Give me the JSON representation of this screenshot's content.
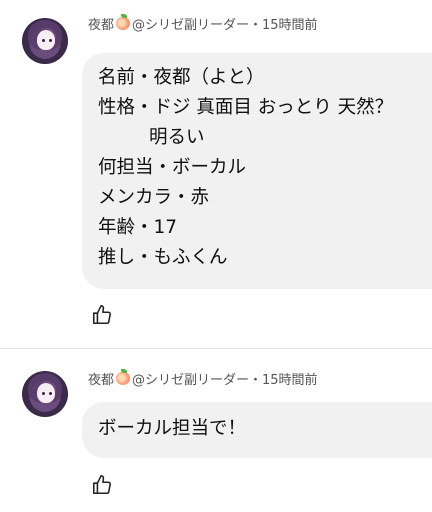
{
  "comments": [
    {
      "author": "夜都",
      "author_suffix": "@シリゼ副リーダー・15時間前",
      "lines": [
        "名前・夜都（よと）",
        "性格・ドジ 真面目 おっとり 天然？",
        "明るい",
        "何担当・ボーカル",
        "メンカラ・赤",
        "年齢・17",
        "推し・もふくん"
      ]
    },
    {
      "author": "夜都",
      "author_suffix": "@シリゼ副リーダー・15時間前",
      "lines": [
        "ボーカル担当で！"
      ]
    }
  ],
  "icons": {
    "like": "thumbs-up-icon",
    "badge": "peach-emoji-icon"
  },
  "colors": {
    "bubble": "#f1f1f1",
    "meta_text": "#555555",
    "divider": "#e3e3e3"
  }
}
